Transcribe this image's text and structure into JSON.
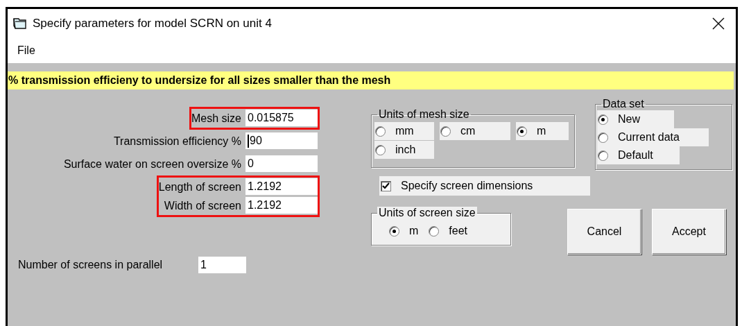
{
  "window": {
    "title": "Specify parameters for model SCRN on unit 4"
  },
  "menu": [
    {
      "label": "File"
    }
  ],
  "hint": "% transmission efficieny to undersize for all sizes smaller than the mesh",
  "fields": [
    {
      "label": "Mesh size",
      "value": "0.015875",
      "highlighted": true,
      "focused": false
    },
    {
      "label": "Transmission efficiency %",
      "value": "90",
      "highlighted": false,
      "focused": true
    },
    {
      "label": "Surface water on screen oversize  %",
      "value": "0",
      "highlighted": false,
      "focused": false
    },
    {
      "label": "Length of screen",
      "value": "1.2192",
      "highlighted": true,
      "focused": false
    },
    {
      "label": "Width of screen",
      "value": "1.2192",
      "highlighted": true,
      "focused": false
    }
  ],
  "screens_in_parallel": {
    "label": "Number of screens in parallel",
    "value": "1"
  },
  "mesh_units": {
    "title": "Units of mesh size",
    "options": [
      {
        "label": "mm",
        "selected": false
      },
      {
        "label": "cm",
        "selected": false
      },
      {
        "label": "m",
        "selected": true
      },
      {
        "label": "inch",
        "selected": false
      }
    ]
  },
  "specify_dimensions": {
    "label": "Specify screen dimensions",
    "checked": true
  },
  "screen_units": {
    "title": "Units of screen size",
    "options": [
      {
        "label": "m",
        "selected": true
      },
      {
        "label": "feet",
        "selected": false
      }
    ]
  },
  "data_set": {
    "title": "Data set",
    "options": [
      {
        "label": "New",
        "selected": true
      },
      {
        "label": "Current data",
        "selected": false
      },
      {
        "label": "Default",
        "selected": false
      }
    ]
  },
  "buttons": [
    {
      "label": "Cancel"
    },
    {
      "label": "Accept"
    }
  ]
}
